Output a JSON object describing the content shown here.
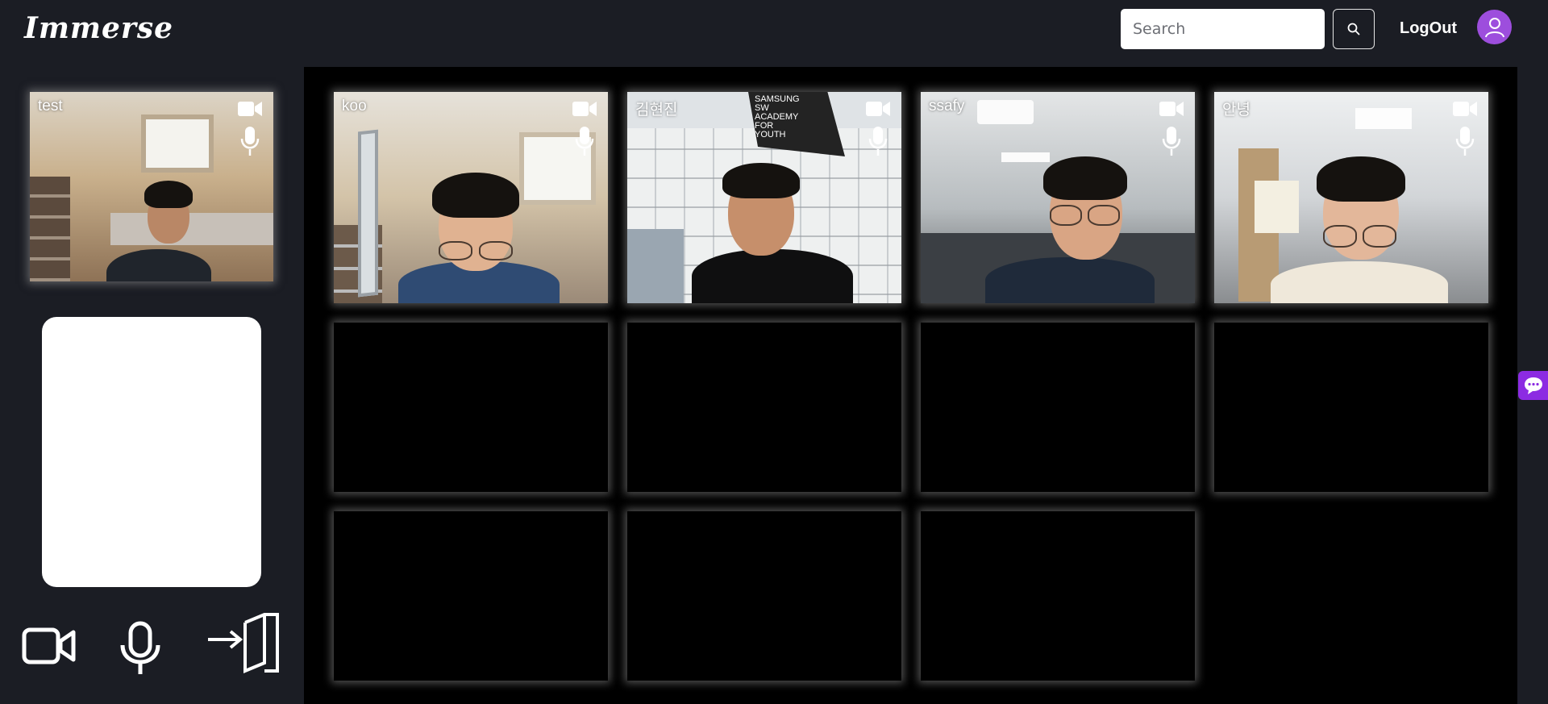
{
  "header": {
    "logo": "Immerse",
    "search": {
      "placeholder": "Search",
      "value": ""
    },
    "logout_label": "LogOut",
    "avatar_color": "#9d4edd"
  },
  "self_tile": {
    "name": "test",
    "camera_icon": "video-camera-icon",
    "mic_icon": "microphone-icon"
  },
  "controls": [
    {
      "name": "camera-toggle-button",
      "icon": "video-camera-icon"
    },
    {
      "name": "mic-toggle-button",
      "icon": "microphone-icon"
    },
    {
      "name": "leave-room-button",
      "icon": "exit-door-icon"
    }
  ],
  "participants": [
    {
      "name": "koo"
    },
    {
      "name": "김현진",
      "banner": [
        "SAMSUNG",
        "SW",
        "ACADEMY",
        "FOR",
        "YOUTH"
      ]
    },
    {
      "name": "ssafy"
    },
    {
      "name": "안녕"
    }
  ],
  "empty_slots": 7,
  "colors": {
    "background": "#1b1d24",
    "stage": "#000000",
    "accent": "#8c2be2"
  }
}
